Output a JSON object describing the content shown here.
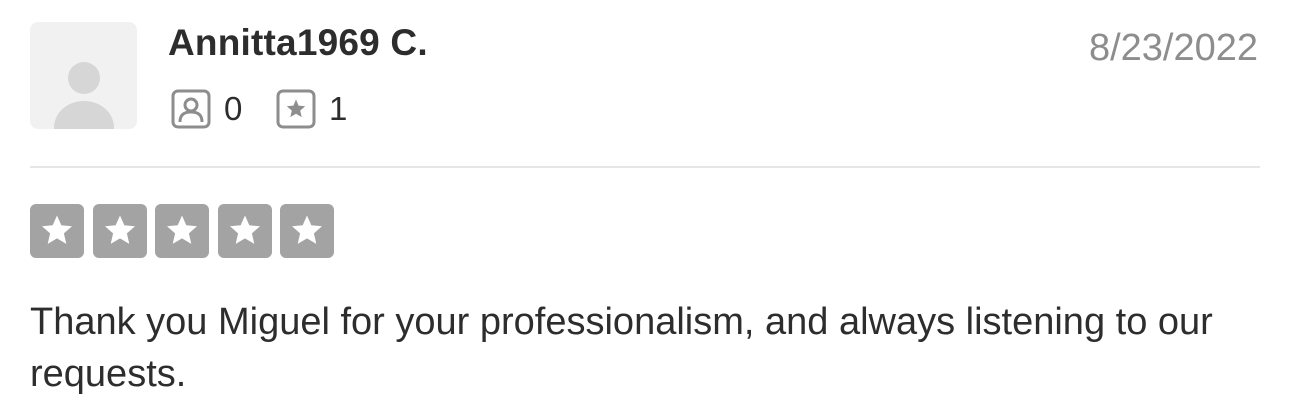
{
  "review": {
    "user": {
      "name": "Annitta1969 C.",
      "avatar_icon": "default-user-avatar-icon",
      "friend_count": "0",
      "review_count": "1"
    },
    "date": "8/23/2022",
    "rating": {
      "value": 5,
      "max": 5,
      "star_color": "#a3a3a3"
    },
    "text": "Thank you Miguel for your professionalism, and always listening to our requests."
  },
  "colors": {
    "text": "#2d2d2d",
    "muted": "#8d8d8d",
    "divider": "#e6e6e6",
    "avatar_bg": "#f1f1f1"
  }
}
